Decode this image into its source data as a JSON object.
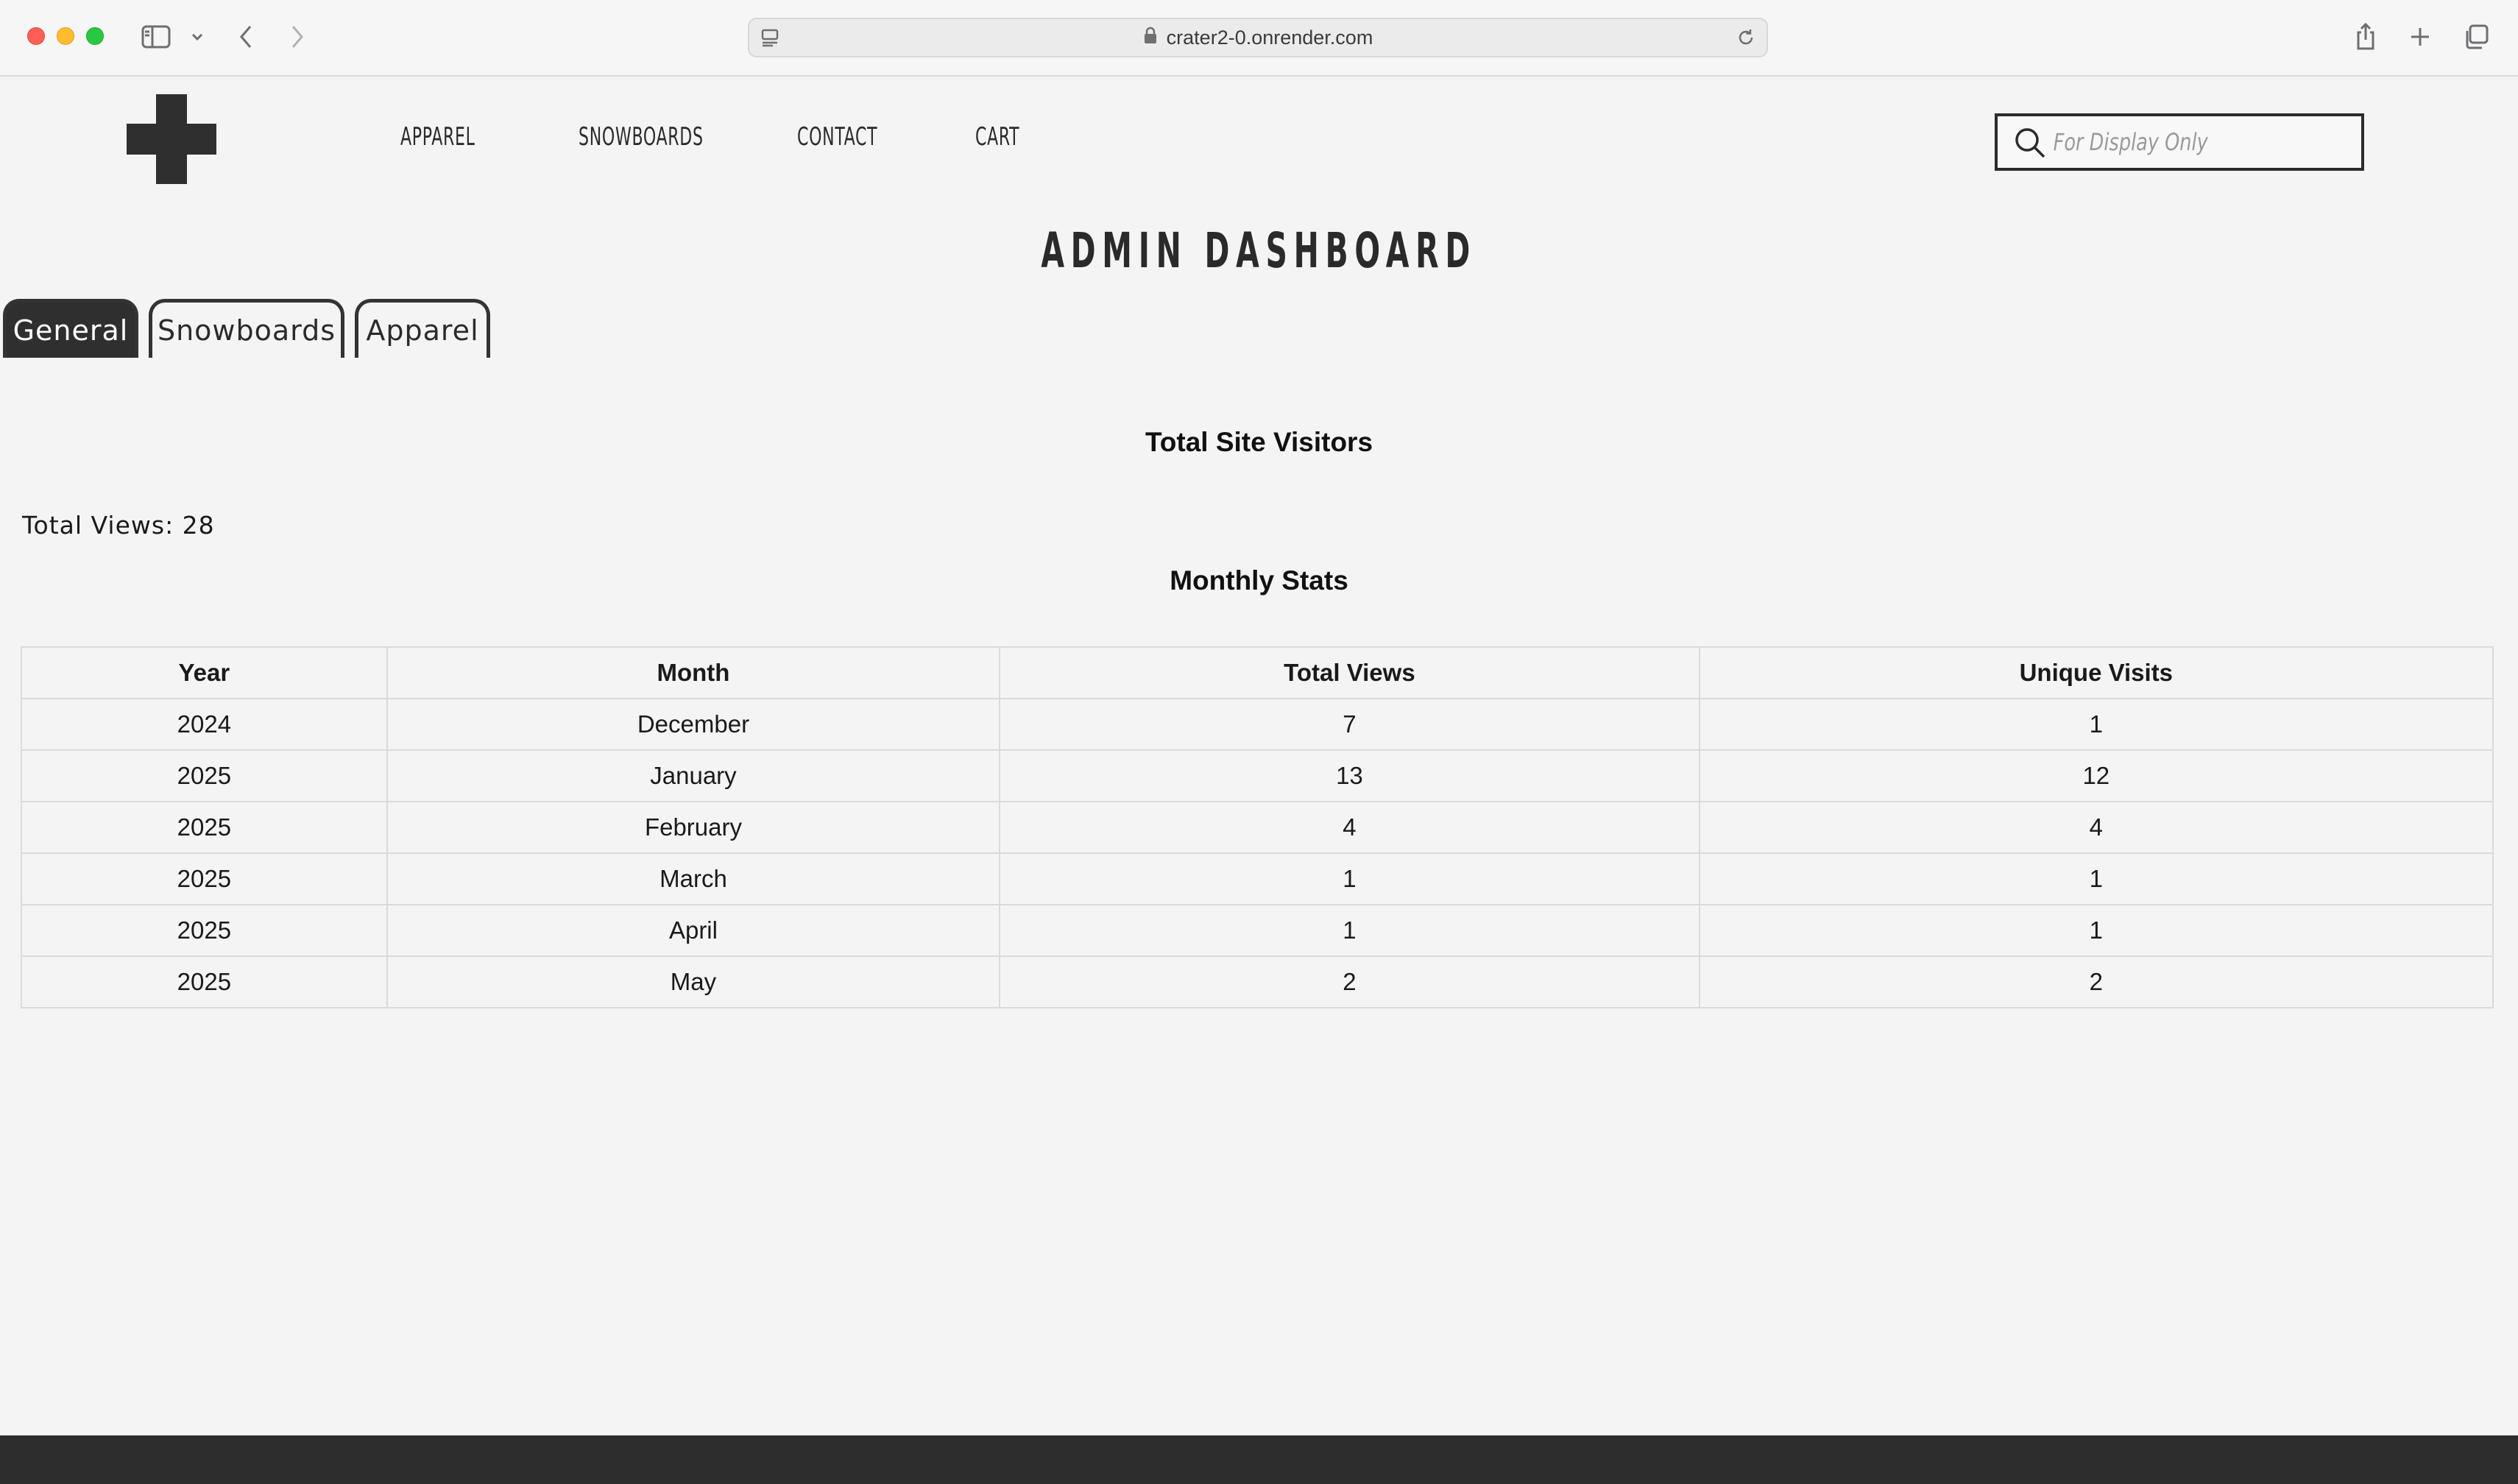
{
  "browser": {
    "url": "crater2-0.onrender.com"
  },
  "header": {
    "logo": "plus-logo",
    "nav": [
      {
        "label": "APPAREL"
      },
      {
        "label": "SNOWBOARDS"
      },
      {
        "label": "CONTACT"
      },
      {
        "label": "CART"
      }
    ],
    "search": {
      "placeholder": "For Display Only",
      "value": ""
    }
  },
  "page": {
    "title": "ADMIN DASHBOARD"
  },
  "tabs": [
    {
      "label": "General",
      "active": true
    },
    {
      "label": "Snowboards",
      "active": false
    },
    {
      "label": "Apparel",
      "active": false
    }
  ],
  "general": {
    "visitors_heading": "Total Site Visitors",
    "total_views_text": "Total Views: 28",
    "monthly_heading": "Monthly Stats",
    "table": {
      "headers": [
        "Year",
        "Month",
        "Total Views",
        "Unique Visits"
      ],
      "rows": [
        [
          "2024",
          "December",
          "7",
          "1"
        ],
        [
          "2025",
          "January",
          "13",
          "12"
        ],
        [
          "2025",
          "February",
          "4",
          "4"
        ],
        [
          "2025",
          "March",
          "1",
          "1"
        ],
        [
          "2025",
          "April",
          "1",
          "1"
        ],
        [
          "2025",
          "May",
          "2",
          "2"
        ]
      ]
    }
  },
  "colors": {
    "page_bg": "#f4f4f4",
    "dark": "#2f2f2f",
    "table_border": "#dadada"
  }
}
